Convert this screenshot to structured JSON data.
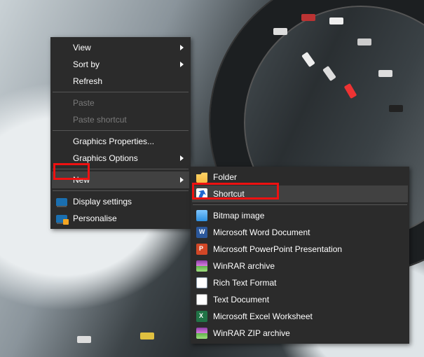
{
  "menu1": {
    "view": "View",
    "sortby": "Sort by",
    "refresh": "Refresh",
    "paste": "Paste",
    "paste_shortcut": "Paste shortcut",
    "gfx_props": "Graphics Properties...",
    "gfx_opts": "Graphics Options",
    "new": "New",
    "display": "Display settings",
    "personalise": "Personalise"
  },
  "menu2": {
    "folder": "Folder",
    "shortcut": "Shortcut",
    "bmp": "Bitmap image",
    "word": "Microsoft Word Document",
    "ppt": "Microsoft PowerPoint Presentation",
    "rar": "WinRAR archive",
    "rtf": "Rich Text Format",
    "txt": "Text Document",
    "xls": "Microsoft Excel Worksheet",
    "zip": "WinRAR ZIP archive"
  }
}
